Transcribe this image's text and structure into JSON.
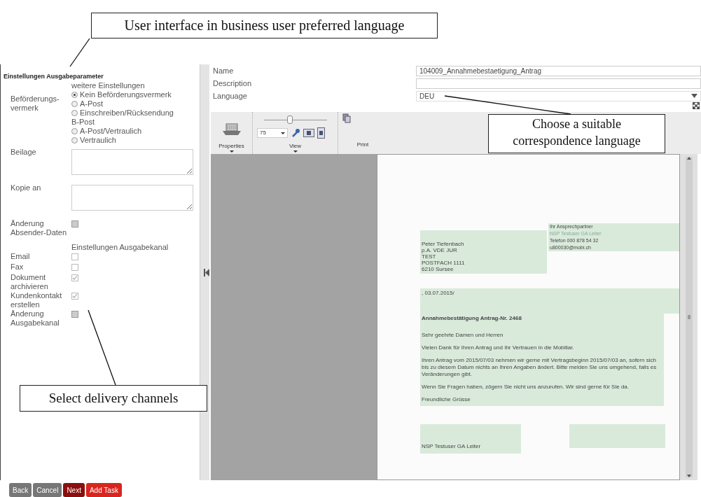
{
  "annotations": [
    {
      "text": "User interface in business user preferred language"
    },
    {
      "text": "Choose a suitable correspondence language"
    },
    {
      "text": "Select delivery channels"
    }
  ],
  "section_title": "Einstellungen Ausgabeparameter",
  "left_form": {
    "rows": [
      {
        "kind": "heading",
        "label": "weitere Einstellungen"
      },
      {
        "kind": "radio-group",
        "label": "Beförderungs-vermerk",
        "options": [
          {
            "kind": "radio",
            "label": "Kein Beförderungsvermerk",
            "selected": true
          },
          {
            "kind": "radio",
            "label": "A-Post",
            "selected": false
          },
          {
            "kind": "radio",
            "label": "Einschreiben/Rücksendung",
            "selected": false
          },
          {
            "kind": "group-label",
            "label": "B-Post"
          },
          {
            "kind": "radio",
            "label": "A-Post/Vertraulich",
            "selected": false
          },
          {
            "kind": "radio",
            "label": "Vertraulich",
            "selected": false
          }
        ]
      },
      {
        "kind": "textarea",
        "label": "Beilage"
      },
      {
        "kind": "textarea",
        "label": "Kopie an"
      },
      {
        "kind": "checkbox",
        "label": "Änderung Absender-Daten",
        "checked": false,
        "disabled": false
      },
      {
        "kind": "heading",
        "label": "Einstellungen Ausgabekanal"
      },
      {
        "kind": "checkbox",
        "label": "Email",
        "checked": false,
        "disabled": true
      },
      {
        "kind": "checkbox",
        "label": "Fax",
        "checked": false,
        "disabled": true
      },
      {
        "kind": "checkbox",
        "label": "Dokument archivieren",
        "checked": true,
        "disabled": true
      },
      {
        "kind": "checkbox",
        "label": "Kundenkontakt erstellen",
        "checked": true,
        "disabled": true
      },
      {
        "kind": "checkbox",
        "label": "Änderung Ausgabekanal",
        "checked": false,
        "disabled": false
      }
    ]
  },
  "fields": [
    {
      "kind": "text",
      "label": "Name",
      "value": "104009_Annahmebestaetigung_Antrag"
    },
    {
      "kind": "text",
      "label": "Description"
    },
    {
      "kind": "select",
      "label": "Language",
      "value": "DEU"
    }
  ],
  "toolbar": {
    "groups": [
      {
        "kind": "properties",
        "label": "Properties"
      },
      {
        "kind": "view",
        "label": "View",
        "zoom": "75",
        "level": 0.4
      },
      {
        "kind": "print",
        "label": "Print"
      }
    ]
  },
  "document": {
    "contact": [
      "Ihr Ansprechpartner",
      "NSP Testuser GA Leiter",
      "Telefon 000 878 54 32",
      "u800030@mobi.ch"
    ],
    "address": [
      "Peter Tiefenbach",
      "p.A. VDE JUR",
      "TEST",
      "POSTFACH 1111",
      "6210 Sursee"
    ],
    "date": ", 03.07.2015/",
    "subject": "Annahmebestätigung Antrag-Nr. 2468",
    "paragraphs": [
      "Sehr geehrte Damen und Herren",
      "Vielen Dank für Ihren Antrag und Ihr Vertrauen in die Mobiliar.",
      "Ihren Antrag vom 2015/07/03 nehmen wir gerne mit Vertragsbeginn 2015/07/03 an, sofern sich bis zu diesem Datum nichts an Ihren Angaben ändert. Bitte melden Sie uns umgehend, falls es Veränderungen gibt.",
      "Wenn Sie Fragen haben, zögern Sie nicht uns anzurufen. Wir sind gerne für Sie da.",
      "Freundliche Grüsse"
    ],
    "signature": "NSP Testuser GA Leiter"
  },
  "buttons": [
    {
      "kind": "neutral",
      "label": "Back"
    },
    {
      "kind": "neutral",
      "label": "Cancel"
    },
    {
      "kind": "primary",
      "label": "Next"
    },
    {
      "kind": "accent",
      "label": "Add Task"
    }
  ]
}
